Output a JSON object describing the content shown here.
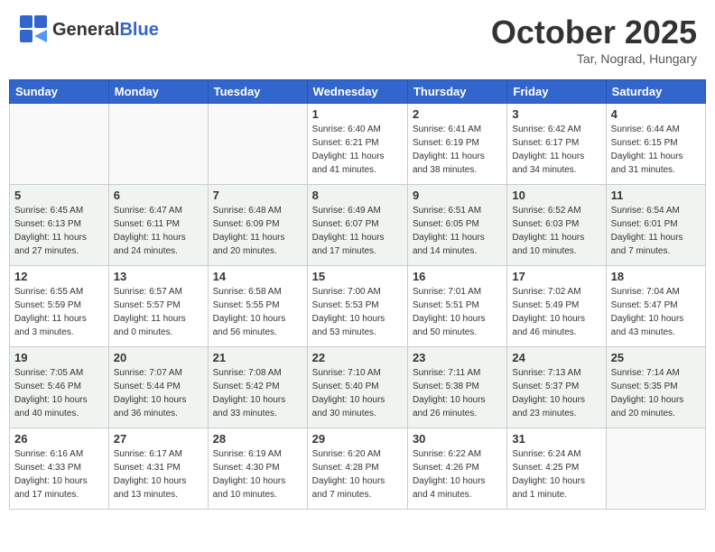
{
  "header": {
    "logo_general": "General",
    "logo_blue": "Blue",
    "month_title": "October 2025",
    "location": "Tar, Nograd, Hungary"
  },
  "weekdays": [
    "Sunday",
    "Monday",
    "Tuesday",
    "Wednesday",
    "Thursday",
    "Friday",
    "Saturday"
  ],
  "weeks": [
    [
      {
        "day": "",
        "info": ""
      },
      {
        "day": "",
        "info": ""
      },
      {
        "day": "",
        "info": ""
      },
      {
        "day": "1",
        "info": "Sunrise: 6:40 AM\nSunset: 6:21 PM\nDaylight: 11 hours\nand 41 minutes."
      },
      {
        "day": "2",
        "info": "Sunrise: 6:41 AM\nSunset: 6:19 PM\nDaylight: 11 hours\nand 38 minutes."
      },
      {
        "day": "3",
        "info": "Sunrise: 6:42 AM\nSunset: 6:17 PM\nDaylight: 11 hours\nand 34 minutes."
      },
      {
        "day": "4",
        "info": "Sunrise: 6:44 AM\nSunset: 6:15 PM\nDaylight: 11 hours\nand 31 minutes."
      }
    ],
    [
      {
        "day": "5",
        "info": "Sunrise: 6:45 AM\nSunset: 6:13 PM\nDaylight: 11 hours\nand 27 minutes."
      },
      {
        "day": "6",
        "info": "Sunrise: 6:47 AM\nSunset: 6:11 PM\nDaylight: 11 hours\nand 24 minutes."
      },
      {
        "day": "7",
        "info": "Sunrise: 6:48 AM\nSunset: 6:09 PM\nDaylight: 11 hours\nand 20 minutes."
      },
      {
        "day": "8",
        "info": "Sunrise: 6:49 AM\nSunset: 6:07 PM\nDaylight: 11 hours\nand 17 minutes."
      },
      {
        "day": "9",
        "info": "Sunrise: 6:51 AM\nSunset: 6:05 PM\nDaylight: 11 hours\nand 14 minutes."
      },
      {
        "day": "10",
        "info": "Sunrise: 6:52 AM\nSunset: 6:03 PM\nDaylight: 11 hours\nand 10 minutes."
      },
      {
        "day": "11",
        "info": "Sunrise: 6:54 AM\nSunset: 6:01 PM\nDaylight: 11 hours\nand 7 minutes."
      }
    ],
    [
      {
        "day": "12",
        "info": "Sunrise: 6:55 AM\nSunset: 5:59 PM\nDaylight: 11 hours\nand 3 minutes."
      },
      {
        "day": "13",
        "info": "Sunrise: 6:57 AM\nSunset: 5:57 PM\nDaylight: 11 hours\nand 0 minutes."
      },
      {
        "day": "14",
        "info": "Sunrise: 6:58 AM\nSunset: 5:55 PM\nDaylight: 10 hours\nand 56 minutes."
      },
      {
        "day": "15",
        "info": "Sunrise: 7:00 AM\nSunset: 5:53 PM\nDaylight: 10 hours\nand 53 minutes."
      },
      {
        "day": "16",
        "info": "Sunrise: 7:01 AM\nSunset: 5:51 PM\nDaylight: 10 hours\nand 50 minutes."
      },
      {
        "day": "17",
        "info": "Sunrise: 7:02 AM\nSunset: 5:49 PM\nDaylight: 10 hours\nand 46 minutes."
      },
      {
        "day": "18",
        "info": "Sunrise: 7:04 AM\nSunset: 5:47 PM\nDaylight: 10 hours\nand 43 minutes."
      }
    ],
    [
      {
        "day": "19",
        "info": "Sunrise: 7:05 AM\nSunset: 5:46 PM\nDaylight: 10 hours\nand 40 minutes."
      },
      {
        "day": "20",
        "info": "Sunrise: 7:07 AM\nSunset: 5:44 PM\nDaylight: 10 hours\nand 36 minutes."
      },
      {
        "day": "21",
        "info": "Sunrise: 7:08 AM\nSunset: 5:42 PM\nDaylight: 10 hours\nand 33 minutes."
      },
      {
        "day": "22",
        "info": "Sunrise: 7:10 AM\nSunset: 5:40 PM\nDaylight: 10 hours\nand 30 minutes."
      },
      {
        "day": "23",
        "info": "Sunrise: 7:11 AM\nSunset: 5:38 PM\nDaylight: 10 hours\nand 26 minutes."
      },
      {
        "day": "24",
        "info": "Sunrise: 7:13 AM\nSunset: 5:37 PM\nDaylight: 10 hours\nand 23 minutes."
      },
      {
        "day": "25",
        "info": "Sunrise: 7:14 AM\nSunset: 5:35 PM\nDaylight: 10 hours\nand 20 minutes."
      }
    ],
    [
      {
        "day": "26",
        "info": "Sunrise: 6:16 AM\nSunset: 4:33 PM\nDaylight: 10 hours\nand 17 minutes."
      },
      {
        "day": "27",
        "info": "Sunrise: 6:17 AM\nSunset: 4:31 PM\nDaylight: 10 hours\nand 13 minutes."
      },
      {
        "day": "28",
        "info": "Sunrise: 6:19 AM\nSunset: 4:30 PM\nDaylight: 10 hours\nand 10 minutes."
      },
      {
        "day": "29",
        "info": "Sunrise: 6:20 AM\nSunset: 4:28 PM\nDaylight: 10 hours\nand 7 minutes."
      },
      {
        "day": "30",
        "info": "Sunrise: 6:22 AM\nSunset: 4:26 PM\nDaylight: 10 hours\nand 4 minutes."
      },
      {
        "day": "31",
        "info": "Sunrise: 6:24 AM\nSunset: 4:25 PM\nDaylight: 10 hours\nand 1 minute."
      },
      {
        "day": "",
        "info": ""
      }
    ]
  ]
}
